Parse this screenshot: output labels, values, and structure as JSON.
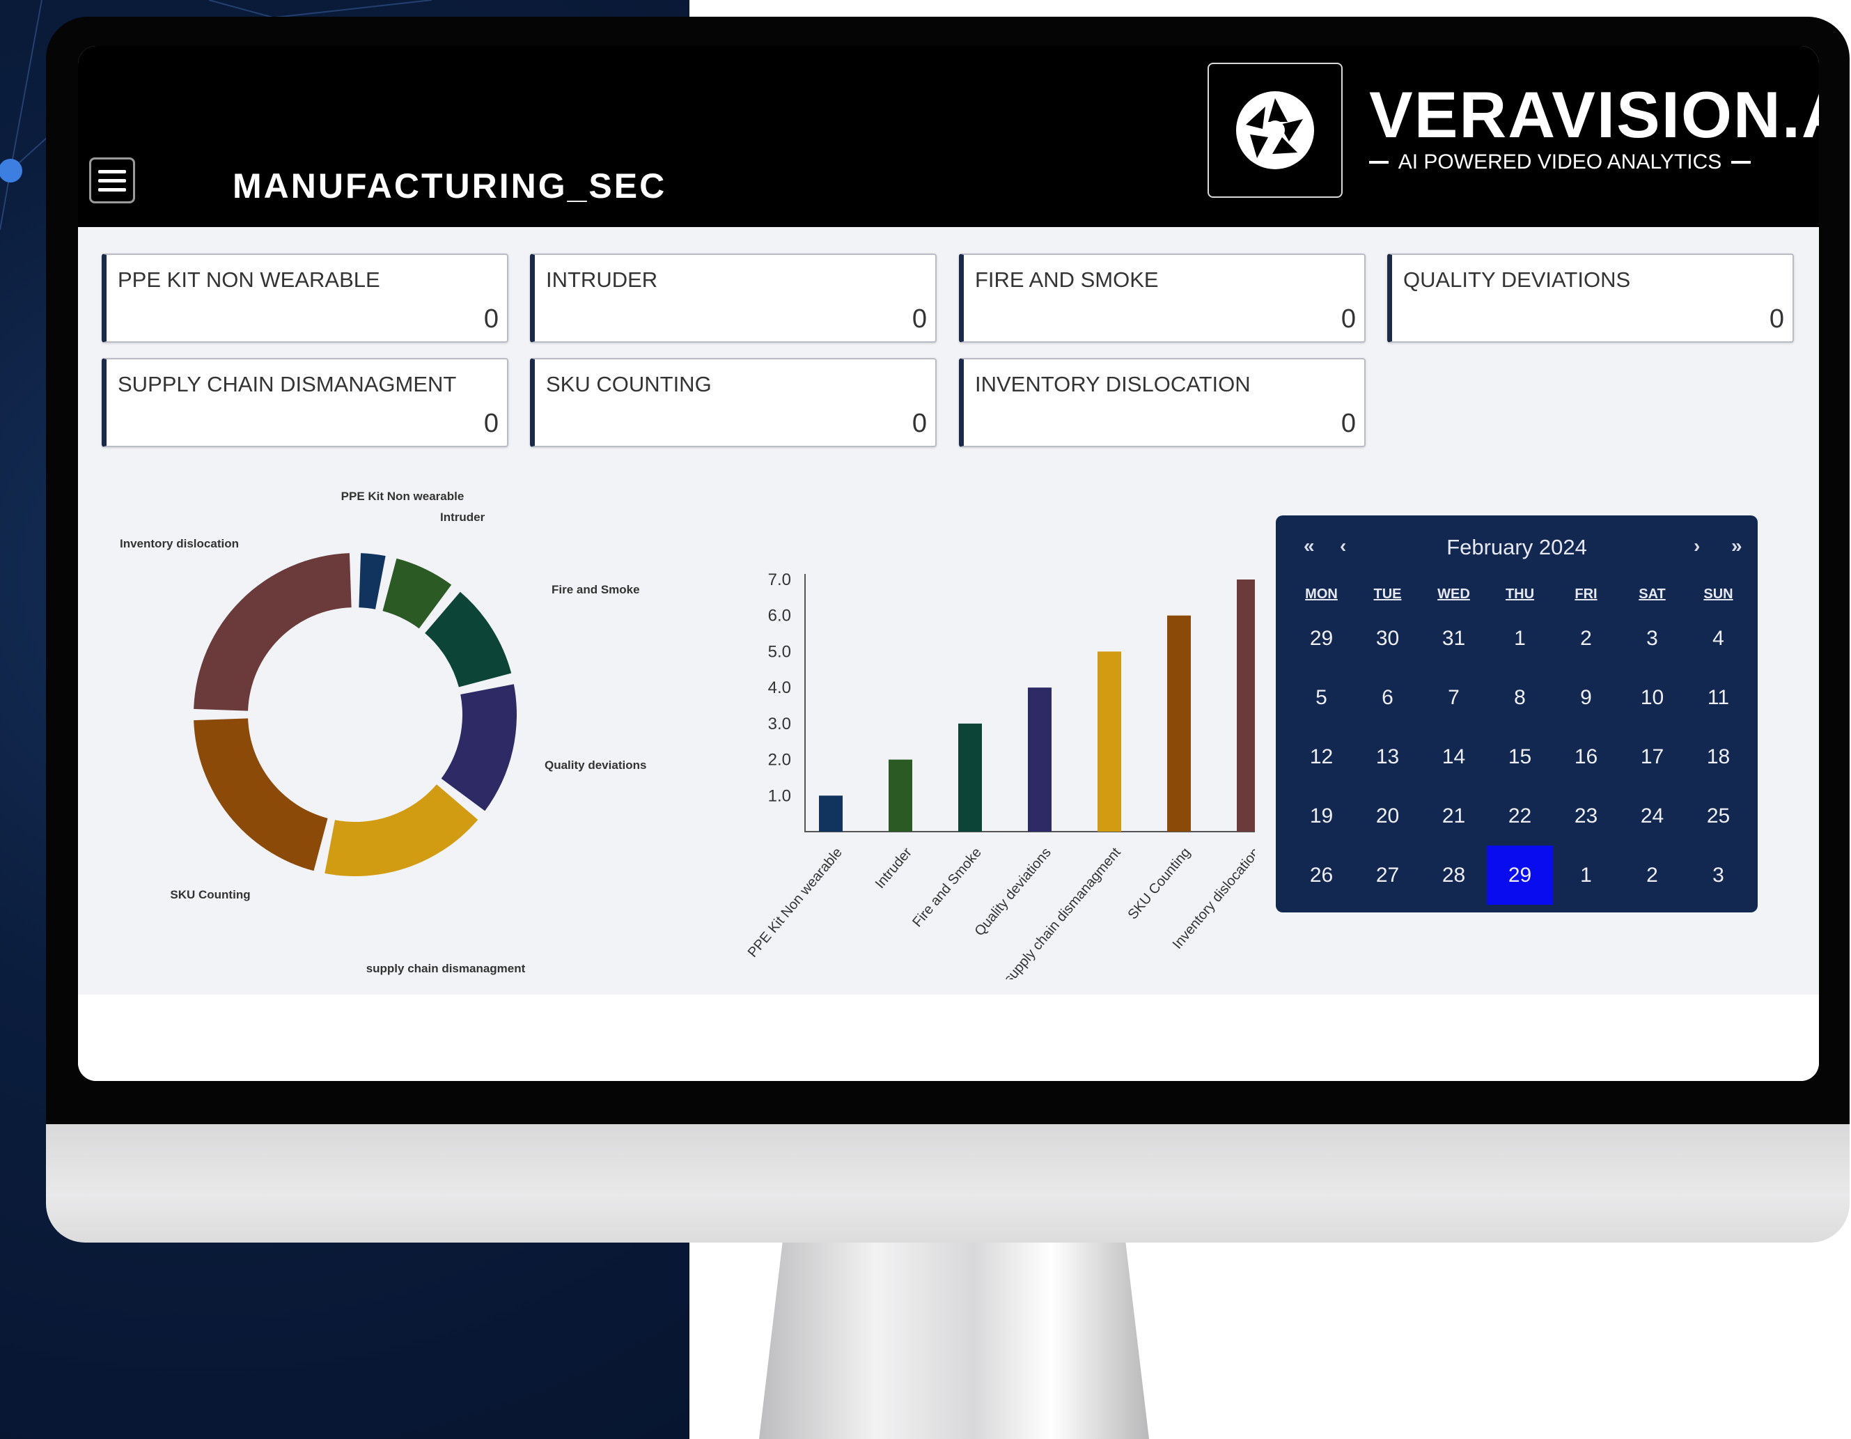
{
  "app": {
    "title": "MANUFACTURING_SEC",
    "brand_name": "VERAVISION.AI",
    "brand_tagline": "AI POWERED VIDEO ANALYTICS",
    "menu_icon": "hamburger-menu-icon",
    "logo_icon": "camera-aperture-icon"
  },
  "cards": [
    {
      "label": "PPE KIT NON WEARABLE",
      "value": "0"
    },
    {
      "label": "INTRUDER",
      "value": "0"
    },
    {
      "label": "FIRE AND SMOKE",
      "value": "0"
    },
    {
      "label": "QUALITY DEVIATIONS",
      "value": "0"
    },
    {
      "label": "SUPPLY CHAIN DISMANAGMENT",
      "value": "0"
    },
    {
      "label": "SKU COUNTING",
      "value": "0"
    },
    {
      "label": "INVENTORY DISLOCATION",
      "value": "0"
    }
  ],
  "chart_data": [
    {
      "type": "pie",
      "donut": true,
      "labels": [
        "PPE Kit Non wearable",
        "Intruder",
        "Fire and Smoke",
        "Quality deviations",
        "supply chain dismanagment",
        "SKU Counting",
        "Inventory dislocation"
      ],
      "values": [
        1,
        2,
        3,
        4,
        5,
        6,
        7
      ],
      "colors": [
        "#10345e",
        "#2b5a24",
        "#0d4438",
        "#2e2a66",
        "#d29c12",
        "#8b4a07",
        "#6b3a3a"
      ]
    },
    {
      "type": "bar",
      "categories": [
        "PPE Kit Non wearable",
        "Intruder",
        "Fire and Smoke",
        "Quality deviations",
        "supply chain dismanagment",
        "SKU Counting",
        "Inventory dislocation"
      ],
      "values": [
        1.0,
        2.0,
        3.0,
        4.0,
        5.0,
        6.0,
        7.0
      ],
      "ylim": [
        0,
        7.0
      ],
      "yticks": [
        "1.0",
        "2.0",
        "3.0",
        "4.0",
        "5.0",
        "6.0",
        "7.0"
      ],
      "colors": [
        "#10345e",
        "#2b5a24",
        "#0d4438",
        "#2e2a66",
        "#d29c12",
        "#8b4a07",
        "#6b3a3a"
      ]
    }
  ],
  "calendar": {
    "month_label": "February 2024",
    "nav": {
      "prev_year": "«",
      "prev_month": "‹",
      "next_month": "›",
      "next_year": "»"
    },
    "weekdays": [
      "MON",
      "TUE",
      "WED",
      "THU",
      "FRI",
      "SAT",
      "SUN"
    ],
    "weeks": [
      [
        "29",
        "30",
        "31",
        "1",
        "2",
        "3",
        "4"
      ],
      [
        "5",
        "6",
        "7",
        "8",
        "9",
        "10",
        "11"
      ],
      [
        "12",
        "13",
        "14",
        "15",
        "16",
        "17",
        "18"
      ],
      [
        "19",
        "20",
        "21",
        "22",
        "23",
        "24",
        "25"
      ],
      [
        "26",
        "27",
        "28",
        "29",
        "1",
        "2",
        "3"
      ]
    ],
    "selected": "29",
    "selected_color": "#0a0cf0"
  }
}
